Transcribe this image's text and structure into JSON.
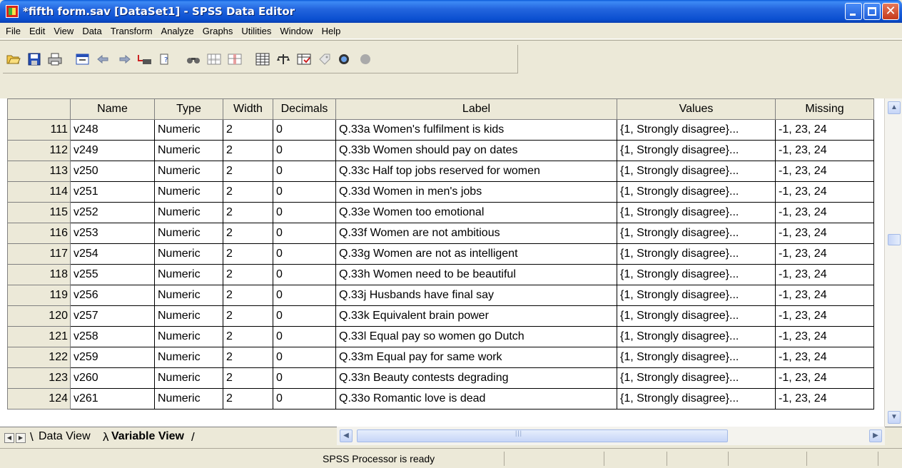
{
  "window": {
    "title": "*fifth form.sav [DataSet1] - SPSS Data Editor"
  },
  "menu": [
    "File",
    "Edit",
    "View",
    "Data",
    "Transform",
    "Analyze",
    "Graphs",
    "Utilities",
    "Window",
    "Help"
  ],
  "toolbar": {
    "icons": [
      "open-icon",
      "save-icon",
      "print-icon",
      "dialog-recall-icon",
      "undo-icon",
      "redo-icon",
      "goto-case-icon",
      "variables-icon",
      "find-icon",
      "insert-cases-icon",
      "insert-variable-icon",
      "split-file-icon",
      "weight-cases-icon",
      "select-cases-icon",
      "value-labels-icon",
      "use-sets-icon",
      "show-all-icon"
    ]
  },
  "grid": {
    "columns": [
      "",
      "Name",
      "Type",
      "Width",
      "Decimals",
      "Label",
      "Values",
      "Missing"
    ],
    "rows": [
      {
        "n": "111",
        "name": "v248",
        "type": "Numeric",
        "width": "2",
        "decimals": "0",
        "label": "Q.33a Women's fulfilment is kids",
        "values": "{1, Strongly disagree}...",
        "missing": "-1, 23, 24"
      },
      {
        "n": "112",
        "name": "v249",
        "type": "Numeric",
        "width": "2",
        "decimals": "0",
        "label": "Q.33b Women should pay on dates",
        "values": "{1, Strongly disagree}...",
        "missing": "-1, 23, 24"
      },
      {
        "n": "113",
        "name": "v250",
        "type": "Numeric",
        "width": "2",
        "decimals": "0",
        "label": "Q.33c Half top jobs reserved for women",
        "values": "{1, Strongly disagree}...",
        "missing": "-1, 23, 24"
      },
      {
        "n": "114",
        "name": "v251",
        "type": "Numeric",
        "width": "2",
        "decimals": "0",
        "label": "Q.33d Women in men's jobs",
        "values": "{1, Strongly disagree}...",
        "missing": "-1, 23, 24"
      },
      {
        "n": "115",
        "name": "v252",
        "type": "Numeric",
        "width": "2",
        "decimals": "0",
        "label": "Q.33e Women too emotional",
        "values": "{1, Strongly disagree}...",
        "missing": "-1, 23, 24"
      },
      {
        "n": "116",
        "name": "v253",
        "type": "Numeric",
        "width": "2",
        "decimals": "0",
        "label": "Q.33f Women are not ambitious",
        "values": "{1, Strongly disagree}...",
        "missing": "-1, 23, 24"
      },
      {
        "n": "117",
        "name": "v254",
        "type": "Numeric",
        "width": "2",
        "decimals": "0",
        "label": "Q.33g Women are not as intelligent",
        "values": "{1, Strongly disagree}...",
        "missing": "-1, 23, 24"
      },
      {
        "n": "118",
        "name": "v255",
        "type": "Numeric",
        "width": "2",
        "decimals": "0",
        "label": "Q.33h Women need to be beautiful",
        "values": "{1, Strongly disagree}...",
        "missing": "-1, 23, 24"
      },
      {
        "n": "119",
        "name": "v256",
        "type": "Numeric",
        "width": "2",
        "decimals": "0",
        "label": "Q.33j Husbands have final say",
        "values": "{1, Strongly disagree}...",
        "missing": "-1, 23, 24"
      },
      {
        "n": "120",
        "name": "v257",
        "type": "Numeric",
        "width": "2",
        "decimals": "0",
        "label": "Q.33k Equivalent brain power",
        "values": "{1, Strongly disagree}...",
        "missing": "-1, 23, 24"
      },
      {
        "n": "121",
        "name": "v258",
        "type": "Numeric",
        "width": "2",
        "decimals": "0",
        "label": "Q.33l Equal pay so women go Dutch",
        "values": "{1, Strongly disagree}...",
        "missing": "-1, 23, 24"
      },
      {
        "n": "122",
        "name": "v259",
        "type": "Numeric",
        "width": "2",
        "decimals": "0",
        "label": "Q.33m Equal pay for same work",
        "values": "{1, Strongly disagree}...",
        "missing": "-1, 23, 24"
      },
      {
        "n": "123",
        "name": "v260",
        "type": "Numeric",
        "width": "2",
        "decimals": "0",
        "label": "Q.33n Beauty contests degrading",
        "values": "{1, Strongly disagree}...",
        "missing": "-1, 23, 24"
      },
      {
        "n": "124",
        "name": "v261",
        "type": "Numeric",
        "width": "2",
        "decimals": "0",
        "label": "Q.33o Romantic love is dead",
        "values": "{1, Strongly disagree}...",
        "missing": "-1, 23, 24"
      }
    ]
  },
  "tabs": {
    "data_view": "Data View",
    "variable_view": "Variable View"
  },
  "status": {
    "text": "SPSS Processor is ready"
  }
}
